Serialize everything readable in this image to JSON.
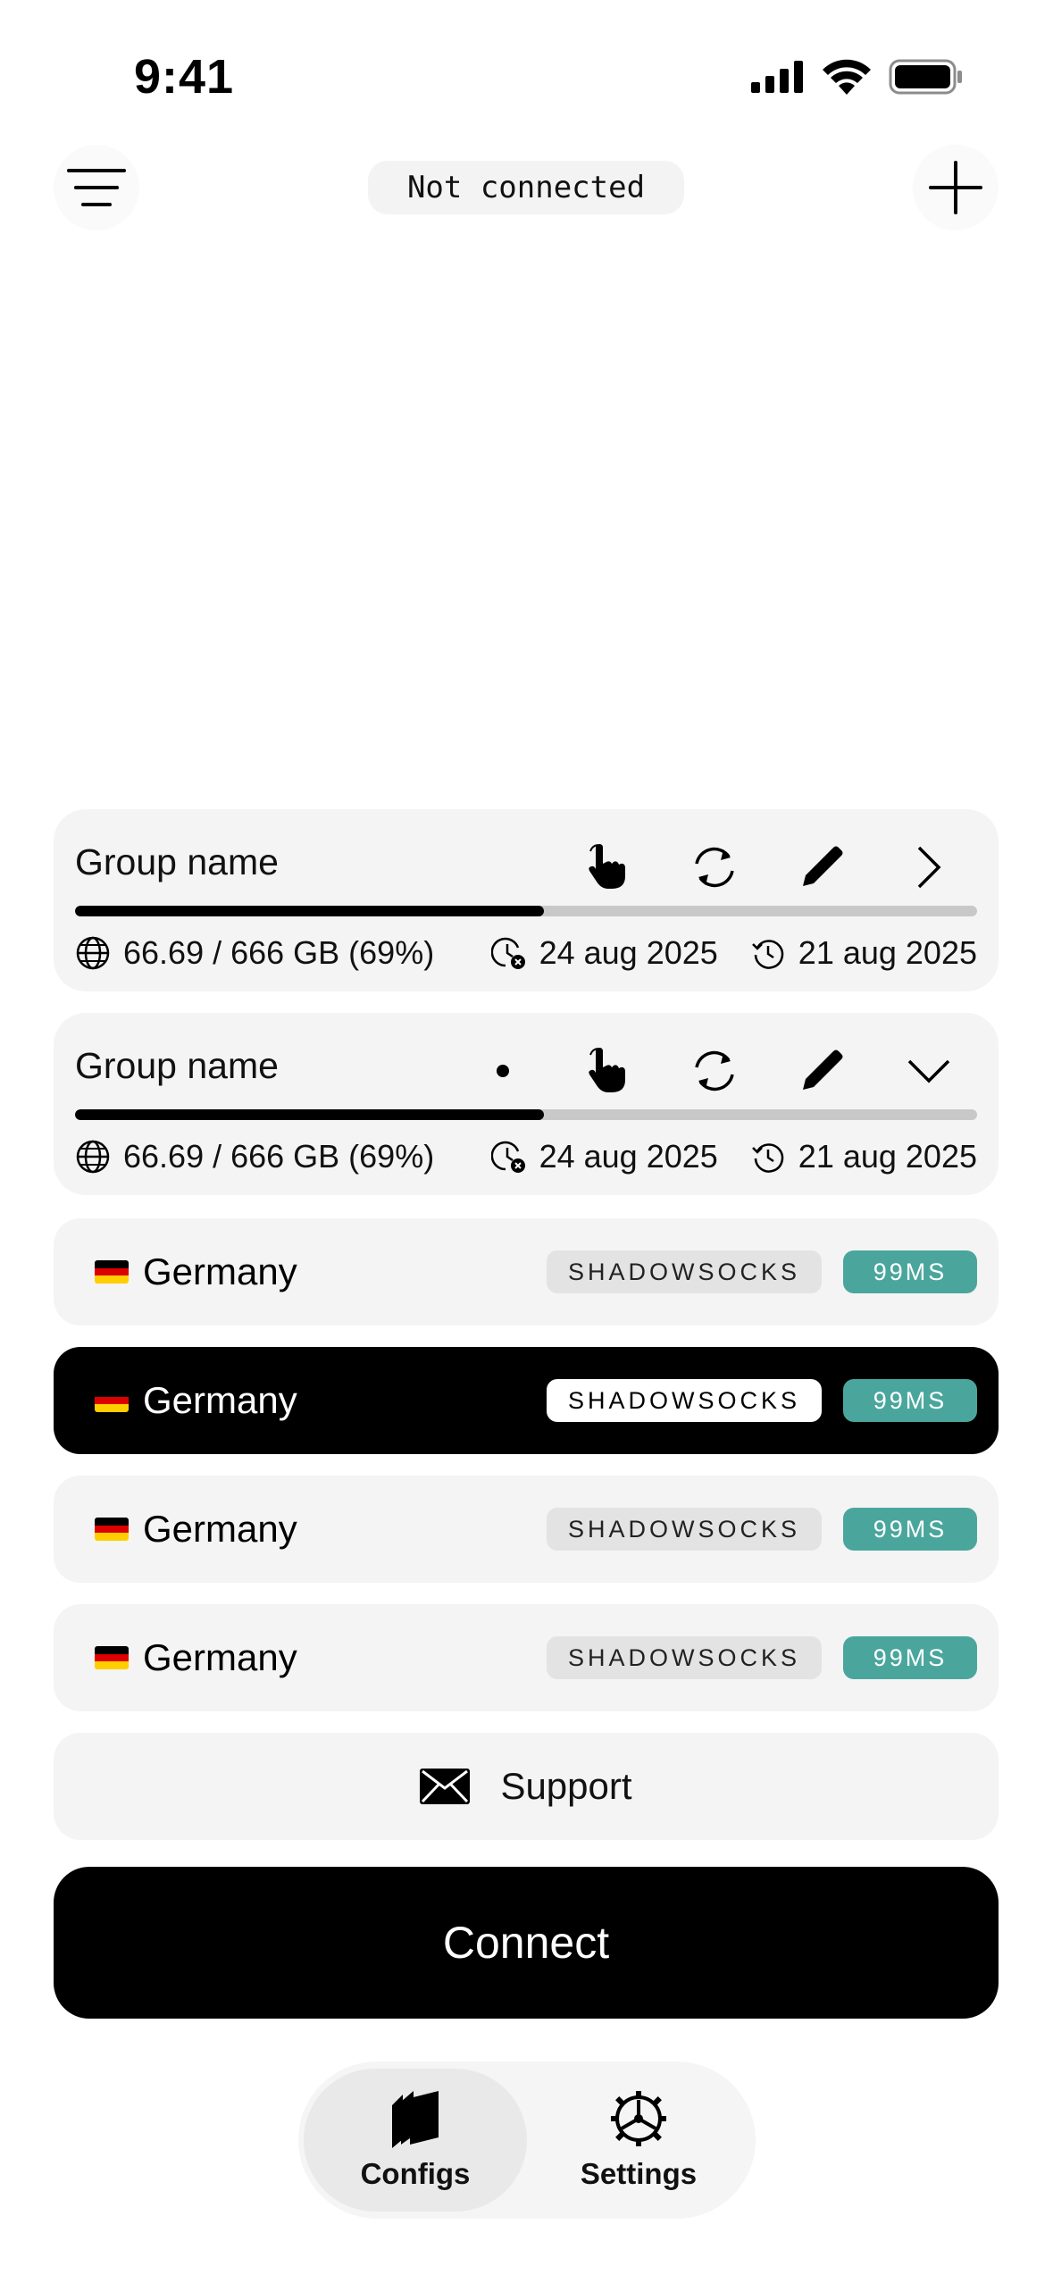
{
  "status_bar": {
    "time": "9:41"
  },
  "header": {
    "connection_status": "Not connected"
  },
  "groups": [
    {
      "name": "Group name",
      "expanded": false,
      "has_dot": false,
      "usage_text": "66.69 / 666 GB (69%)",
      "usage_fraction": 0.52,
      "expire_date": "24 aug 2025",
      "updated_date": "21 aug 2025"
    },
    {
      "name": "Group name",
      "expanded": true,
      "has_dot": true,
      "usage_text": "66.69 / 666 GB (69%)",
      "usage_fraction": 0.52,
      "expire_date": "24 aug 2025",
      "updated_date": "21 aug 2025"
    }
  ],
  "servers": [
    {
      "country": "Germany",
      "protocol": "SHADOWSOCKS",
      "ping": "99MS",
      "selected": false
    },
    {
      "country": "Germany",
      "protocol": "SHADOWSOCKS",
      "ping": "99MS",
      "selected": true
    },
    {
      "country": "Germany",
      "protocol": "SHADOWSOCKS",
      "ping": "99MS",
      "selected": false
    },
    {
      "country": "Germany",
      "protocol": "SHADOWSOCKS",
      "ping": "99MS",
      "selected": false
    }
  ],
  "support": {
    "label": "Support"
  },
  "connect": {
    "label": "Connect"
  },
  "tabs": [
    {
      "label": "Configs",
      "icon": "configs-icon",
      "active": true
    },
    {
      "label": "Settings",
      "icon": "gear-icon",
      "active": false
    }
  ],
  "colors": {
    "accent_ping": "#4aa69d",
    "selected_row": "#000000",
    "card_bg": "#f4f4f4"
  }
}
